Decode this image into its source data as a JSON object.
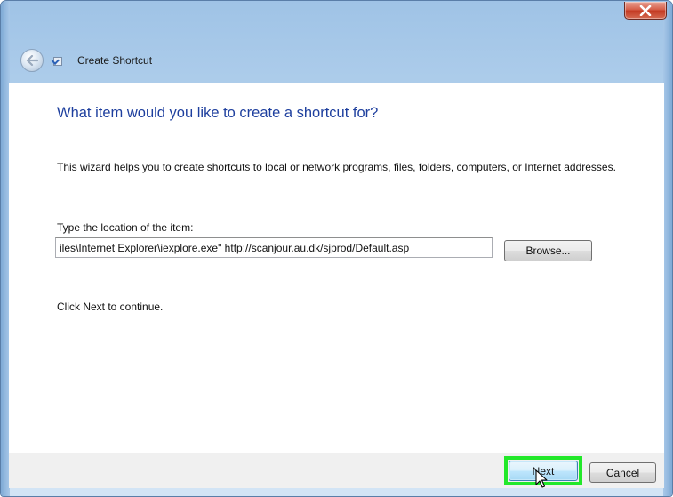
{
  "window": {
    "header_title": "Create Shortcut",
    "close_glyph": "x"
  },
  "content": {
    "heading": "What item would you like to create a shortcut for?",
    "description": "This wizard helps you to create shortcuts to local or network programs, files, folders, computers, or Internet addresses.",
    "location_label": "Type the location of the item:",
    "location_value": "iles\\Internet Explorer\\iexplore.exe\" http://scanjour.au.dk/sjprod/Default.asp",
    "browse_label": "Browse...",
    "continue_text": "Click Next to continue."
  },
  "footer": {
    "next_label": "Next",
    "cancel_label": "Cancel"
  },
  "colors": {
    "heading": "#1e3f9e",
    "highlight": "#22e82a",
    "close_button": "#c33a22"
  },
  "icons": [
    "back-arrow-icon",
    "wizard-shortcut-icon",
    "close-icon",
    "mouse-cursor-icon"
  ]
}
